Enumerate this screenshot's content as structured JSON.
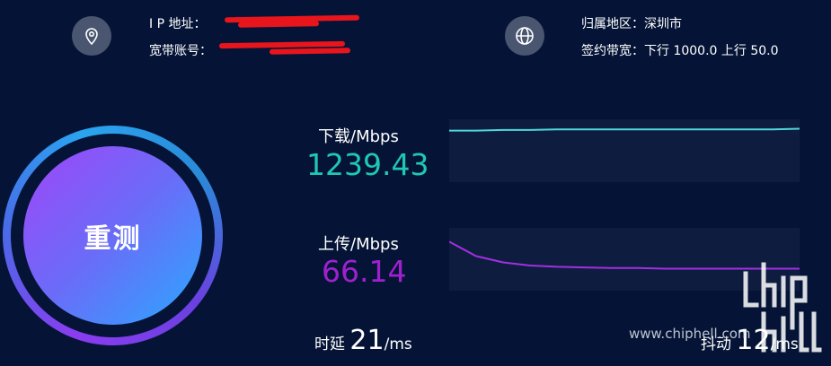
{
  "header": {
    "ip_label": "I P 地址：",
    "account_label": "宽带账号：",
    "region_label": "归属地区：深圳市",
    "bandwidth_label": "签约带宽：下行 1000.0 上行 50.0"
  },
  "icons": {
    "location": "location-pin-icon",
    "globe": "globe-icon"
  },
  "retest": {
    "label": "重测"
  },
  "download": {
    "label": "下载/Mbps",
    "value": "1239.43",
    "color": "#1fc8b4",
    "line_color": "#4fd8d8"
  },
  "upload": {
    "label": "上传/Mbps",
    "value": "66.14",
    "color": "#a020d0",
    "line_color": "#a030e0"
  },
  "latency": {
    "label": "时延",
    "value": "21",
    "unit": "/ms"
  },
  "jitter": {
    "label": "抖动",
    "value": "12",
    "unit": "/ms"
  },
  "watermark": {
    "url": "www.chiphell.com",
    "logo_text": "chiphell"
  },
  "chart_data": [
    {
      "type": "line",
      "name": "download",
      "values": [
        0.82,
        0.82,
        0.83,
        0.83,
        0.84,
        0.84,
        0.84,
        0.84,
        0.84,
        0.84,
        0.84,
        0.84,
        0.84,
        0.85
      ]
    },
    {
      "type": "line",
      "name": "upload",
      "values": [
        0.78,
        0.55,
        0.45,
        0.4,
        0.38,
        0.37,
        0.36,
        0.36,
        0.35,
        0.35,
        0.35,
        0.35,
        0.35,
        0.35
      ]
    }
  ]
}
